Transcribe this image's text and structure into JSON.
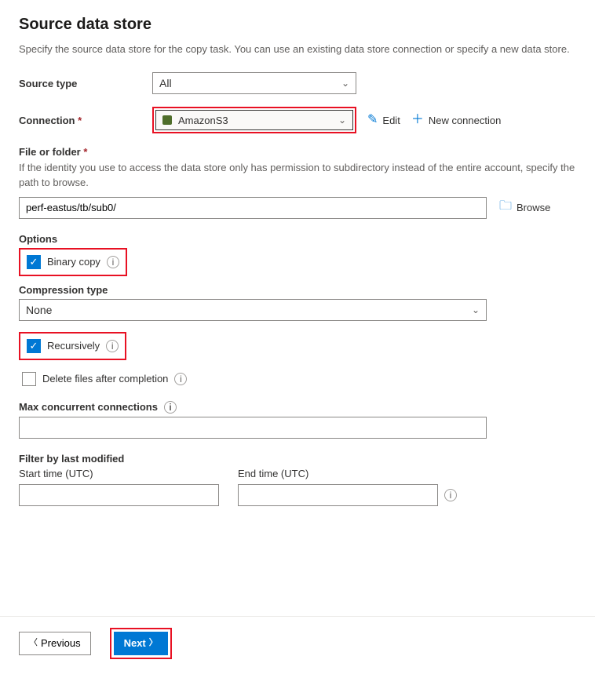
{
  "header": {
    "title": "Source data store",
    "subtitle": "Specify the source data store for the copy task. You can use an existing data store connection or specify a new data store."
  },
  "source_type": {
    "label": "Source type",
    "value": "All"
  },
  "connection": {
    "label": "Connection",
    "value": "AmazonS3",
    "edit": "Edit",
    "new": "New connection"
  },
  "file": {
    "label": "File or folder",
    "helper": "If the identity you use to access the data store only has permission to subdirectory instead of the entire account, specify the path to browse.",
    "value": "perf-eastus/tb/sub0/",
    "browse": "Browse"
  },
  "options": {
    "label": "Options",
    "binary_copy": "Binary copy",
    "compression_label": "Compression type",
    "compression_value": "None",
    "recursively": "Recursively",
    "delete_after": "Delete files after completion",
    "max_conn": "Max concurrent connections"
  },
  "filter": {
    "label": "Filter by last modified",
    "start": "Start time (UTC)",
    "end": "End time (UTC)"
  },
  "footer": {
    "previous": "Previous",
    "next": "Next"
  }
}
